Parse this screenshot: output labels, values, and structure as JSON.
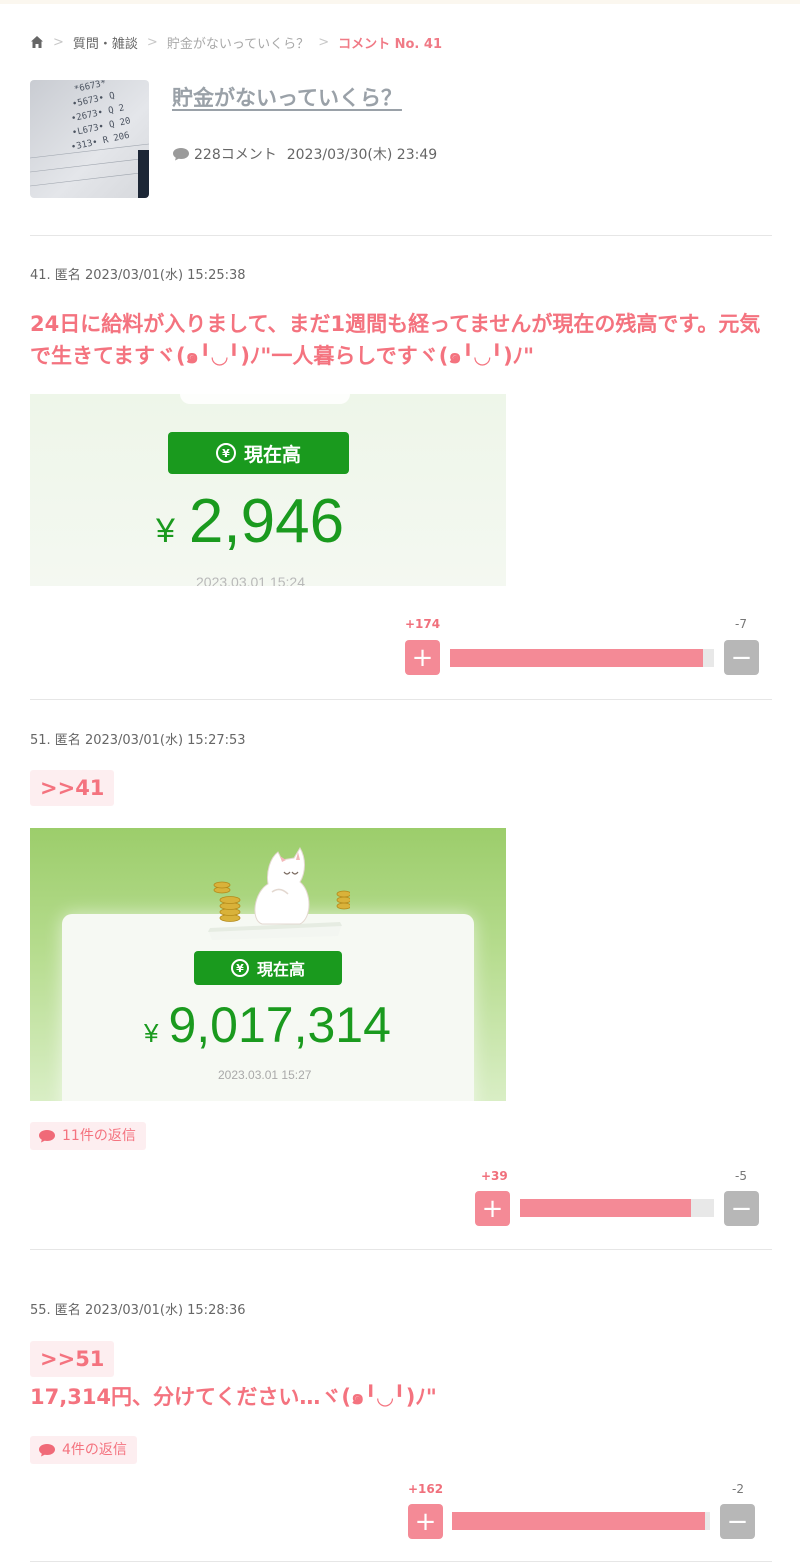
{
  "breadcrumb": {
    "category": "質問・雑談",
    "topic": "貯金がないっていくら？",
    "current": "コメント No. 41"
  },
  "topic": {
    "title": "貯金がないっていくら？",
    "comment_count": "228コメント",
    "date": "2023/03/30(木) 23:49"
  },
  "comments": [
    {
      "header": "41. 匿名 2023/03/01(水) 15:25:38",
      "body": "24日に給料が入りまして、まだ1週間も経ってませんが現在の残高です。元気で生きてますヾ(๑╹◡╹)ﾉ\"一人暮らしですヾ(๑╹◡╹)ﾉ\"",
      "image": {
        "label": "現在高",
        "yen": "¥",
        "amount": "2,946",
        "timestamp": "2023.03.01 15:24"
      },
      "votes": {
        "plus": "+174",
        "minus": "-7",
        "ratio": 0.96
      }
    },
    {
      "header": "51. 匿名 2023/03/01(水) 15:27:53",
      "anchor": ">>41",
      "image": {
        "label": "現在高",
        "yen": "¥",
        "amount": "9,017,314",
        "timestamp": "2023.03.01 15:27"
      },
      "replies": "11件の返信",
      "votes": {
        "plus": "+39",
        "minus": "-5",
        "ratio": 0.88
      }
    },
    {
      "header": "55. 匿名 2023/03/01(水) 15:28:36",
      "anchor": ">>51",
      "body": "17,314円、分けてください…ヾ(๑╹◡╹)ﾉ\"",
      "replies": "4件の返信",
      "votes": {
        "plus": "+162",
        "minus": "-2",
        "ratio": 0.98
      }
    }
  ],
  "colors": {
    "accent_pink": "#f4737f",
    "vote_bar": "#f48a96",
    "balance_green": "#1a9a1e"
  },
  "icons": [
    "home-icon",
    "chevron-right-icon",
    "speech-bubble-icon",
    "plus-icon",
    "minus-icon",
    "yen-circle-icon",
    "cat-illustration"
  ]
}
